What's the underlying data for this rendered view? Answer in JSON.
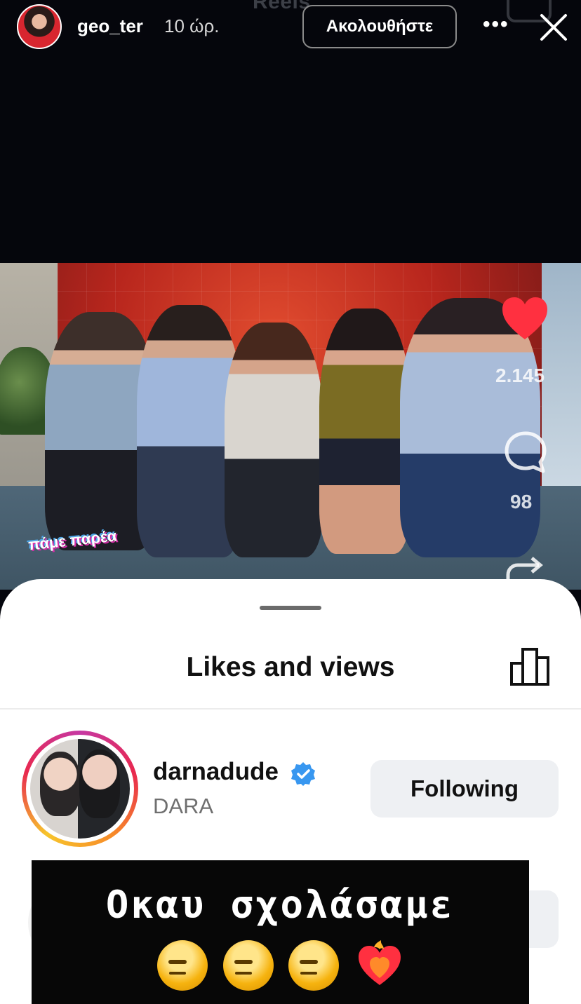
{
  "story_header": {
    "username": "geo_ter",
    "time_ago": "10 ώρ.",
    "follow_label": "Ακολουθήστε",
    "more_label": "•••",
    "background_text": "Reels"
  },
  "reel": {
    "likes_count": "2.145",
    "comments_count": "98",
    "show_logo": "πάμε παρέα"
  },
  "sheet": {
    "title": "Likes and views",
    "user": {
      "username": "darnadude",
      "full_name": "DARA",
      "button_label": "Following"
    }
  },
  "caption": {
    "text": "Οκαυ σχολάσαμε",
    "emojis": "🫠🫠🫠❤️‍🔥"
  },
  "colors": {
    "heart": "#ff3040",
    "verified": "#3897f0",
    "following_button_bg": "#eef0f3"
  }
}
